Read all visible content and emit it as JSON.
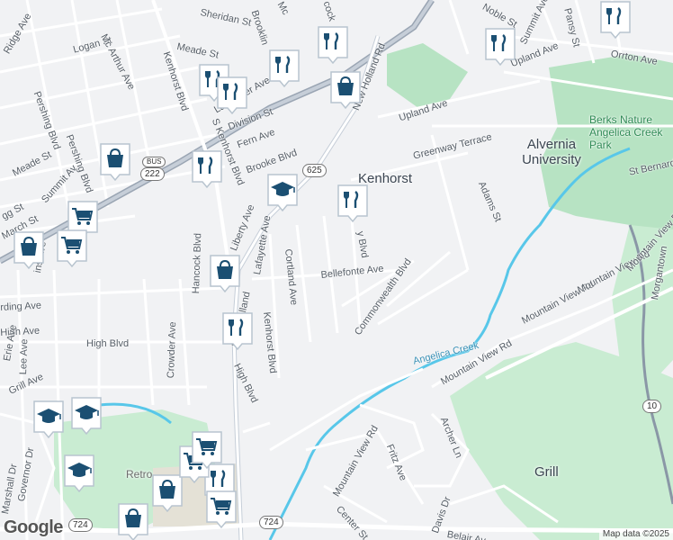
{
  "map": {
    "attribution": "Map data ©2025",
    "logo": "Google",
    "colors": {
      "background": "#f1f2f4",
      "road": "#ffffff",
      "highway": "#9aa5b3",
      "park": "#b7e3c3",
      "water": "#58c7e9",
      "marker": "#1b4f72"
    },
    "places": {
      "kenhorst": "Kenhorst",
      "alvernia": "Alvernia University",
      "berks_park": "Berks Nature Angelica Creek Park",
      "grill": "Grill",
      "retro": "Retro"
    },
    "streets": {
      "ridge_ave": "Ridge Ave",
      "logan_st": "Logan St",
      "mcarthur_ave": "Mc Arthur Ave",
      "meade_st_top": "Meade St",
      "sheridan_st": "Sheridan St",
      "brookline": "Brooklin",
      "mc": "Mc",
      "cock": "cock",
      "kenhorst_blvd_n": "Kenhorst Blvd",
      "lancaster_ave": "Lancaster Ave",
      "pershing_blvd1": "Pershing Blvd",
      "pershing_blvd2": "Pershing Blvd",
      "division_st": "Division St",
      "fern_ave": "Fern Ave",
      "brooke_blvd": "Brooke Blvd",
      "s_kenhorst_blvd": "S Kenhorst Blvd",
      "new_holland_rd": "New Holland Rd",
      "upland_ave_top": "Upland Ave",
      "upland_ave": "Upland Ave",
      "greenway_terrace": "Greenway Terrace",
      "adams_st": "Adams St",
      "st_bernardine": "St Bernardi",
      "meade_st_left": "Meade St",
      "summit_av": "Summit Av",
      "march_st": "March St",
      "gg_st": "gg St",
      "liberty_ave": "Liberty Ave",
      "lafayette_ave": "Lafayette Ave",
      "new_holland_lower": "New Holland",
      "bellefonte_ave": "Bellefonte Ave",
      "cortland_ave": "Cortland Ave",
      "commonwealth_blvd": "Commonwealth Blvd",
      "y_blvd": "y Blvd",
      "rding_ave": "rding Ave",
      "high_ave": "High Ave",
      "high_blvd": "High Blvd",
      "hancock_blvd": "Hancock Blvd",
      "crowder_ave": "Crowder Ave",
      "kenhorst_blvd_s": "Kenhorst Blvd",
      "high_blvd_s": "High Blvd",
      "lee_ave": "Lee Ave",
      "erie_ave": "Erie Ave",
      "grill_ave": "Grill Ave",
      "ins_ave": "ins Ave",
      "mountain_view_rd1": "Mountain View Rd",
      "mountain_view_rd2": "Mountain View Rd",
      "mountain_view_rd3": "Mountain View Rd",
      "mountain_view_rd4": "Mountain View Rd",
      "mountain_view_rd5": "Mountain View Rd",
      "morgantown": "Morgantown",
      "angelica_creek": "Angelica Creek",
      "archer_ln": "Archer Ln",
      "fritz_ave": "Fritz Ave",
      "center_st": "Center St",
      "davis_dr": "Davis Dr",
      "belair_av": "Belair Av",
      "marshall_dr": "Marshall Dr",
      "governor_dr": "Governor Dr",
      "pansy_st": "Pansy St",
      "orrton_ave": "Orrton Ave",
      "noble_st": "Noble St",
      "summit_ave_top": "Summit Ave"
    },
    "shields": {
      "r625": "625",
      "r222": "222",
      "bus": "BUS",
      "r724a": "724",
      "r724b": "724",
      "r10": "10"
    },
    "markers": [
      {
        "type": "restaurant",
        "icon": "fork-knife-icon"
      },
      {
        "type": "restaurant",
        "icon": "fork-knife-icon"
      },
      {
        "type": "restaurant",
        "icon": "fork-knife-icon"
      },
      {
        "type": "restaurant",
        "icon": "fork-knife-icon"
      },
      {
        "type": "restaurant",
        "icon": "fork-knife-icon"
      },
      {
        "type": "restaurant",
        "icon": "fork-knife-icon"
      },
      {
        "type": "restaurant",
        "icon": "fork-knife-icon"
      },
      {
        "type": "restaurant",
        "icon": "fork-knife-icon"
      },
      {
        "type": "restaurant",
        "icon": "fork-knife-icon"
      },
      {
        "type": "shopping",
        "icon": "shopping-bag-icon"
      },
      {
        "type": "shopping",
        "icon": "shopping-bag-icon"
      },
      {
        "type": "shopping",
        "icon": "shopping-bag-icon"
      },
      {
        "type": "shopping",
        "icon": "shopping-bag-icon"
      },
      {
        "type": "shopping",
        "icon": "shopping-bag-icon"
      },
      {
        "type": "shopping",
        "icon": "shopping-bag-icon"
      },
      {
        "type": "grocery",
        "icon": "shopping-cart-icon"
      },
      {
        "type": "grocery",
        "icon": "shopping-cart-icon"
      },
      {
        "type": "grocery",
        "icon": "shopping-cart-icon"
      },
      {
        "type": "grocery",
        "icon": "shopping-cart-icon"
      },
      {
        "type": "grocery",
        "icon": "shopping-cart-icon"
      },
      {
        "type": "school",
        "icon": "graduation-cap-icon"
      },
      {
        "type": "school",
        "icon": "graduation-cap-icon"
      },
      {
        "type": "school",
        "icon": "graduation-cap-icon"
      },
      {
        "type": "school",
        "icon": "graduation-cap-icon"
      },
      {
        "type": "restaurant",
        "icon": "fork-knife-icon"
      }
    ]
  }
}
